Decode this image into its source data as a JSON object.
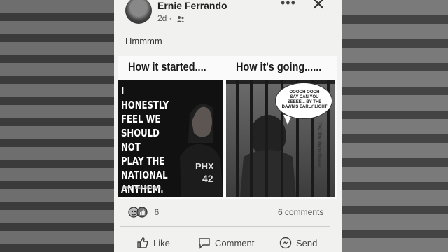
{
  "post": {
    "author": "Ernie Ferrando",
    "time": "2d",
    "audience_icon": "friends-icon",
    "text": "Hmmmm"
  },
  "meme": {
    "left_header": "How it started....",
    "right_header": "How it's going......",
    "quote": "I HONESTLY\nFEEL WE\nSHOULD NOT\nPLAY THE\nNATIONAL\nANTHEM.",
    "attribution": "BRITTNEY GRINER",
    "bubble": "OOOOH OOOH\nSAY CAN YOU\nSEEEE... BY THE\nDAWN'S EARLY LIGHT",
    "watermark": "TKO The Meme Master"
  },
  "footer": {
    "reaction_count": "6",
    "comments": "6 comments",
    "like": "Like",
    "comment": "Comment",
    "send": "Send"
  },
  "colors": {
    "paper": "#f1f1ef",
    "text": "#222222",
    "background": "#5b5b5b"
  }
}
